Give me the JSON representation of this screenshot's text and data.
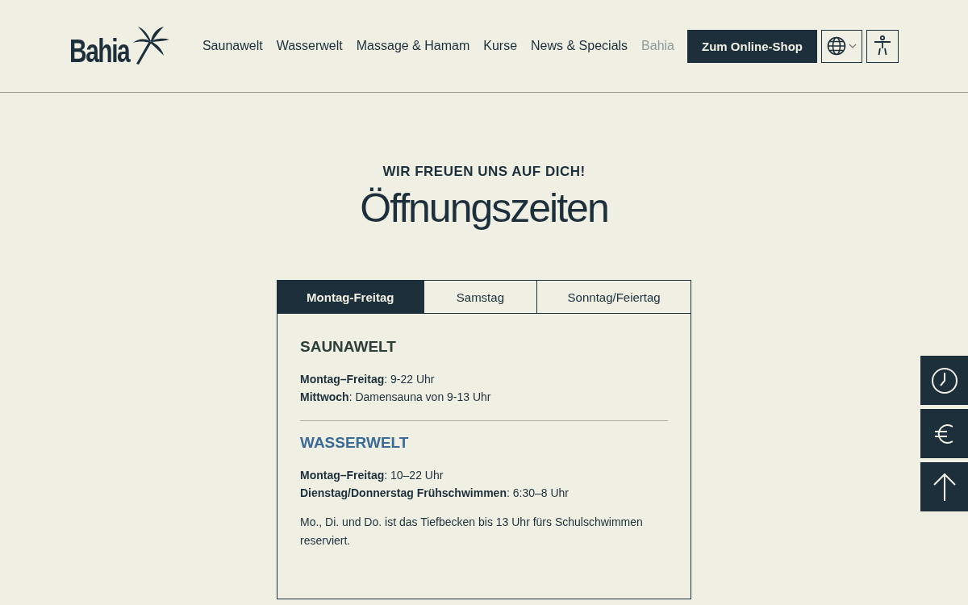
{
  "header": {
    "logo": "Bahia",
    "nav": [
      {
        "label": "Saunawelt",
        "selected": false
      },
      {
        "label": "Wasserwelt",
        "selected": false
      },
      {
        "label": "Massage & Hamam",
        "selected": false
      },
      {
        "label": "Kurse",
        "selected": false
      },
      {
        "label": "News & Specials",
        "selected": false
      },
      {
        "label": "Bahia",
        "selected": true
      }
    ],
    "shop_button": "Zum Online-Shop"
  },
  "intro": {
    "kicker": "WIR FREUEN UNS AUF DICH!",
    "title": "Öffnungszeiten"
  },
  "tabs": [
    {
      "label": "Montag-Freitag",
      "selected": true
    },
    {
      "label": "Samstag",
      "selected": false
    },
    {
      "label": "Sonntag/Feiertag",
      "selected": false
    }
  ],
  "sections": [
    {
      "title": "SAUNAWELT",
      "kind": "sauna",
      "lines": [
        "**Montag–Freitag**: 9-22 Uhr",
        "**Mittwoch**:  Damensauna von 9-13 Uhr"
      ]
    },
    {
      "title": "WASSERWELT",
      "kind": "water",
      "lines": [
        "**Montag–Freitag**: 10–22 Uhr",
        "**Dienstag/Donnerstag Frühschwimmen**: 6:30–8 Uhr"
      ],
      "note": "Mo., Di. und Do. ist das Tiefbecken bis 13 Uhr fürs Schulschwimmen reserviert."
    }
  ],
  "side_buttons": [
    {
      "kind": "clock"
    },
    {
      "kind": "euro"
    },
    {
      "kind": "top"
    }
  ]
}
